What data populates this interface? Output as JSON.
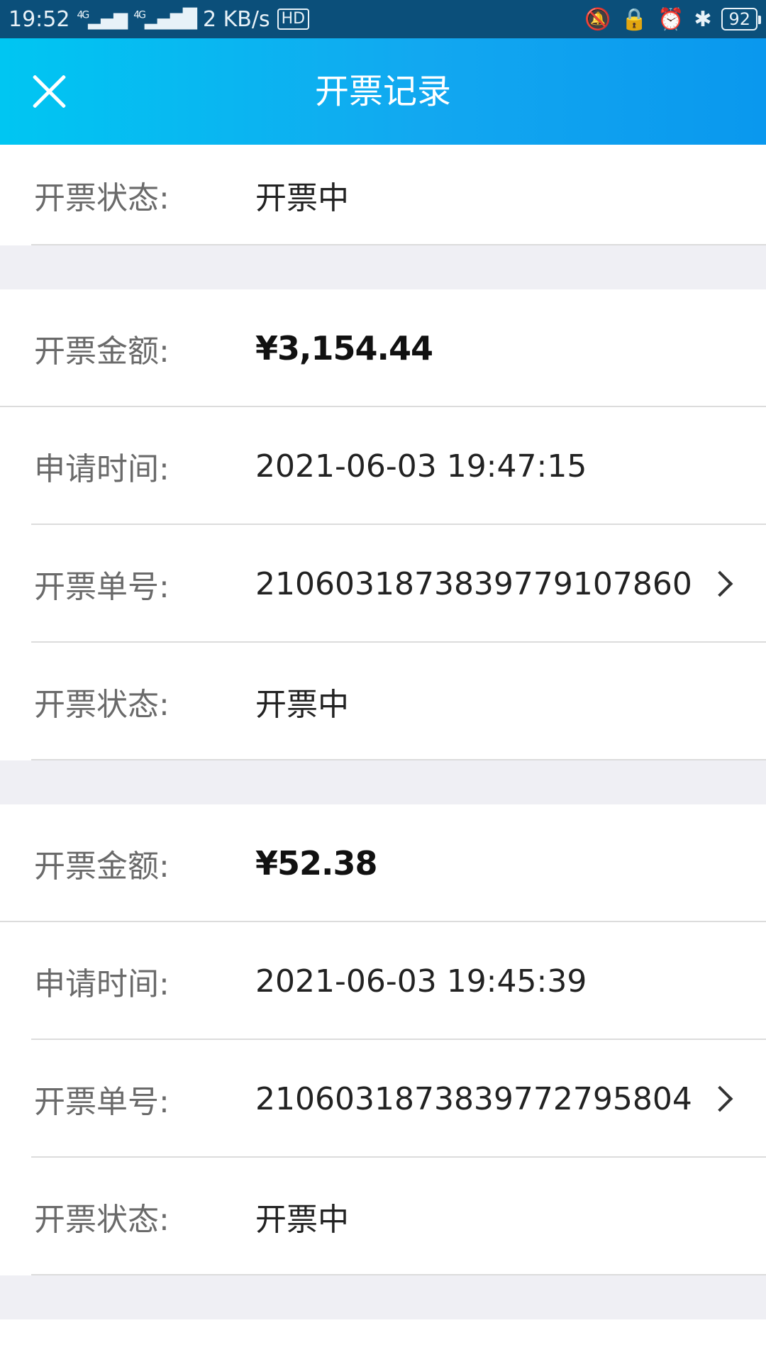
{
  "status_bar": {
    "time": "19:52",
    "net1": "4G",
    "net2": "4G",
    "speed": "2 KB/s",
    "hd": "HD",
    "battery": "92"
  },
  "header": {
    "title": "开票记录"
  },
  "partial_card": {
    "status_label": "开票状态:",
    "status_value": "开票中"
  },
  "records": [
    {
      "amount_label": "开票金额:",
      "amount": "¥3,154.44",
      "time_label": "申请时间:",
      "time": "2021-06-03 19:47:15",
      "order_label": "开票单号:",
      "order": "21060318738397791078​60",
      "status_label": "开票状态:",
      "status": "开票中"
    },
    {
      "amount_label": "开票金额:",
      "amount": "¥52.38",
      "time_label": "申请时间:",
      "time": "2021-06-03 19:45:39",
      "order_label": "开票单号:",
      "order": "21060318738397727958​04",
      "status_label": "开票状态:",
      "status": "开票中"
    }
  ]
}
